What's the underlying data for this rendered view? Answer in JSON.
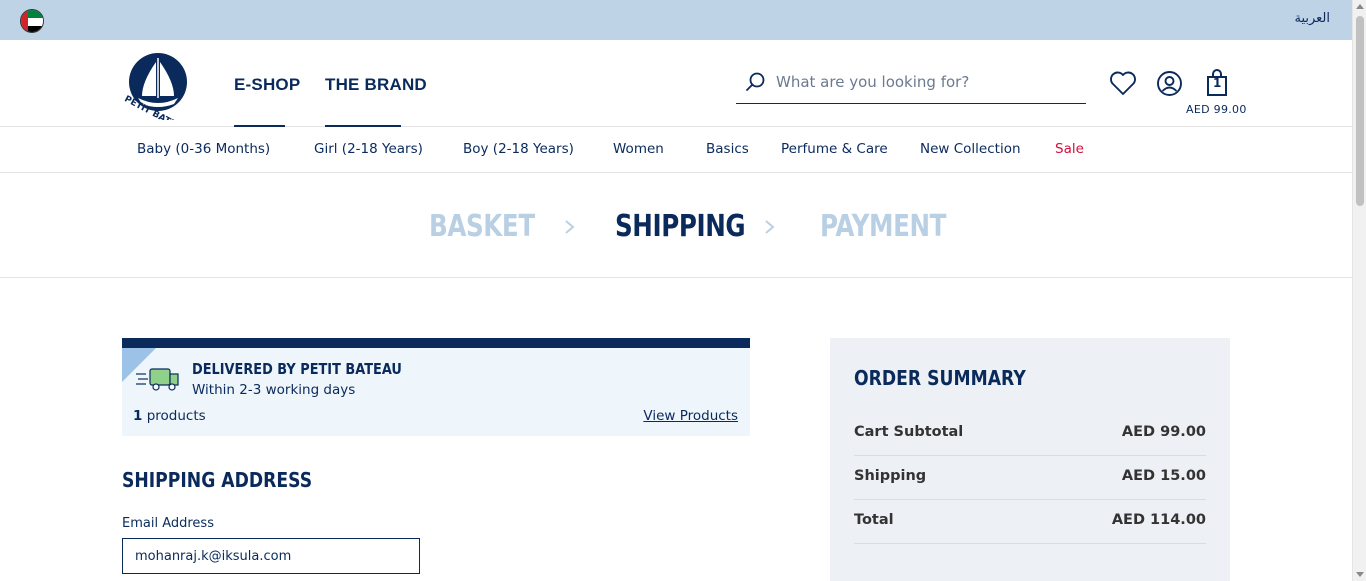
{
  "topbar": {
    "language_label": "العربية"
  },
  "header": {
    "logo_text": "PETIT BATEAU",
    "nav": [
      "E-SHOP",
      "THE BRAND"
    ],
    "search_placeholder": "What are you looking for?",
    "cart_count": "1",
    "cart_total": "AED 99.00"
  },
  "categories": [
    "Baby (0-36 Months)",
    "Girl (2-18 Years)",
    "Boy (2-18 Years)",
    "Women",
    "Basics",
    "Perfume & Care",
    "New Collection",
    "Sale"
  ],
  "steps": {
    "basket": "BASKET",
    "shipping": "SHIPPING",
    "payment": "PAYMENT"
  },
  "delivery": {
    "title": "DELIVERED BY PETIT BATEAU",
    "subtitle": "Within 2-3 working days",
    "count": "1",
    "count_suffix": " products",
    "view_link": "View Products"
  },
  "shipping_address": {
    "title": "SHIPPING ADDRESS",
    "email_label": "Email Address",
    "email_value": "mohanraj.k@iksula.com"
  },
  "order_summary": {
    "title": "ORDER SUMMARY",
    "rows": [
      {
        "label": "Cart Subtotal",
        "value": "AED 99.00"
      },
      {
        "label": "Shipping",
        "value": "AED 15.00"
      },
      {
        "label": "Total",
        "value": "AED 114.00"
      }
    ]
  },
  "colors": {
    "brand_navy": "#0a2a5c",
    "topbar": "#bed3e5",
    "sale": "#d1103c",
    "inactive_step": "#b9d0e4"
  }
}
